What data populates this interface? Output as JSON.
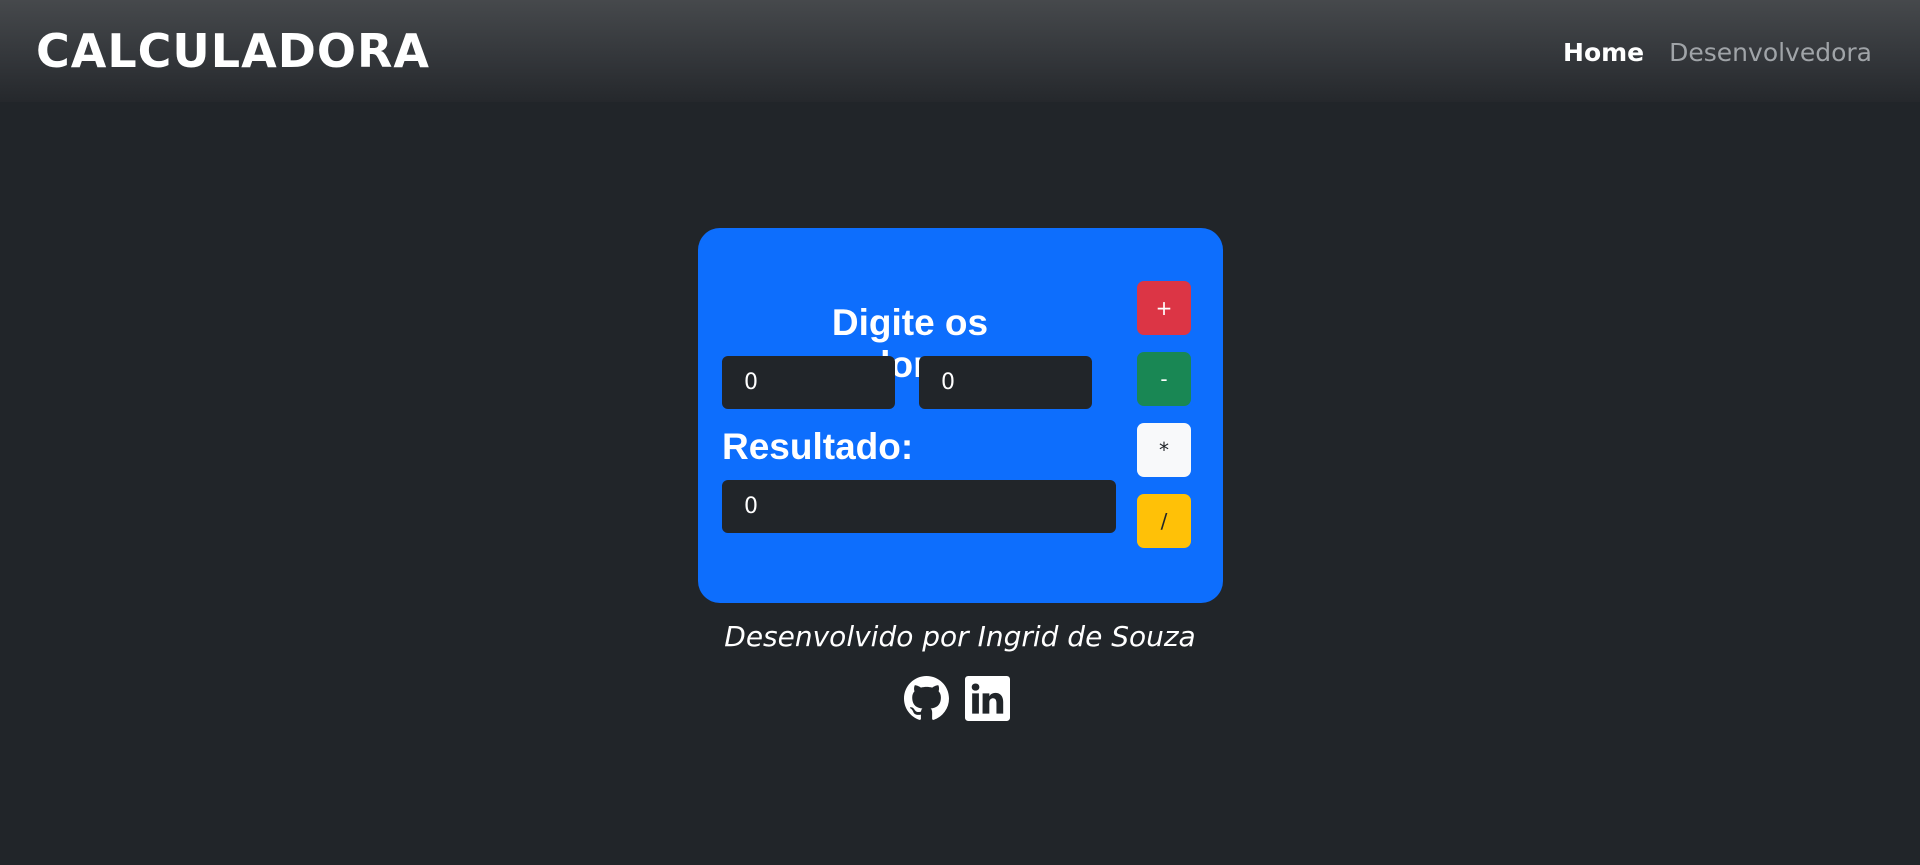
{
  "navbar": {
    "brand": "CALCULADORA",
    "links": [
      {
        "label": "Home",
        "active": true
      },
      {
        "label": "Desenvolvedora",
        "active": false
      }
    ]
  },
  "calculator": {
    "input_label": "Digite os valores:",
    "value1": "0",
    "value2": "0",
    "result_label": "Resultado:",
    "result_value": "0",
    "operations": {
      "add": "+",
      "subtract": "-",
      "multiply": "*",
      "divide": "/"
    }
  },
  "footer": {
    "credit": "Desenvolvido por Ingrid de Souza",
    "icons": [
      "github-icon",
      "linkedin-icon"
    ]
  },
  "colors": {
    "background": "#212529",
    "card": "#0d6efd",
    "add": "#dc3545",
    "subtract": "#198754",
    "multiply": "#f8f9fa",
    "divide": "#ffc107"
  }
}
